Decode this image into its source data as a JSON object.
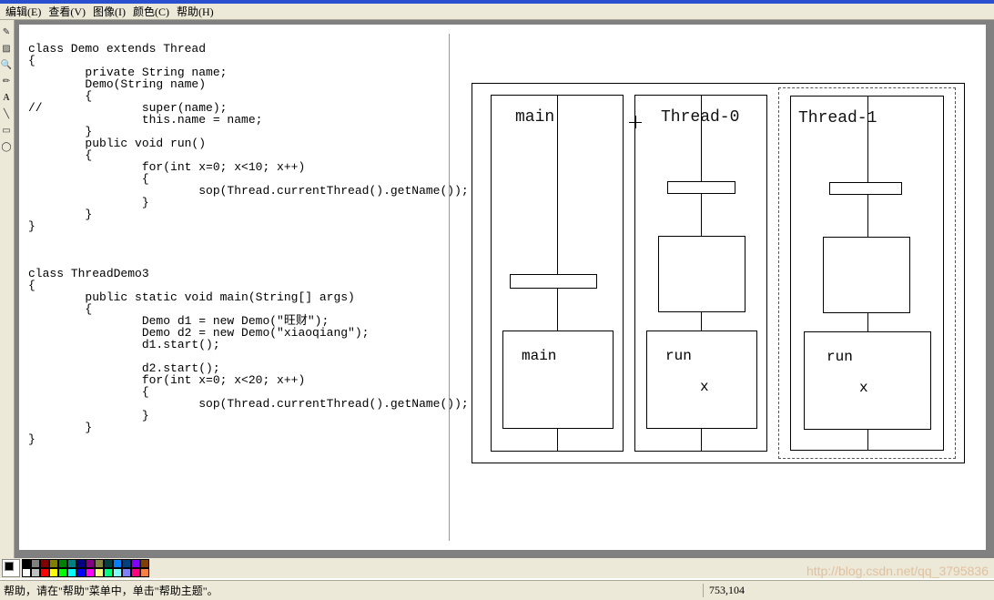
{
  "menu": {
    "edit": "编辑(E)",
    "view": "查看(V)",
    "image": "图像(I)",
    "color": "颜色(C)",
    "help": "帮助(H)"
  },
  "code": {
    "text": "class Demo extends Thread\n{\n        private String name;\n        Demo(String name)\n        {\n//              super(name);\n                this.name = name;\n        }\n        public void run()\n        {\n                for(int x=0; x<10; x++)\n                {\n                        sop(Thread.currentThread().getName());\n                }\n        }\n}\n\n\n\nclass ThreadDemo3\n{\n        public static void main(String[] args)\n        {\n                Demo d1 = new Demo(\"旺财\");\n                Demo d2 = new Demo(\"xiaoqiang\");\n                d1.start();\n\n                d2.start();\n                for(int x=0; x<20; x++)\n                {\n                        sop(Thread.currentThread().getName());\n                }\n        }\n}"
  },
  "diagram": {
    "thread1": {
      "title": "main",
      "box": "main"
    },
    "thread2": {
      "title": "Thread-0",
      "box": "run",
      "var": "x"
    },
    "thread3": {
      "title": "Thread-1",
      "box": "run",
      "var": "x"
    }
  },
  "palette": {
    "row1": [
      "#000000",
      "#808080",
      "#800000",
      "#808000",
      "#008000",
      "#008080",
      "#000080",
      "#800080",
      "#808040",
      "#004040",
      "#0080ff",
      "#004080",
      "#8000ff",
      "#804000"
    ],
    "row2": [
      "#ffffff",
      "#c0c0c0",
      "#ff0000",
      "#ffff00",
      "#00ff00",
      "#00ffff",
      "#0000ff",
      "#ff00ff",
      "#ffff80",
      "#00ff80",
      "#80ffff",
      "#8080ff",
      "#ff0080",
      "#ff8040"
    ]
  },
  "status": {
    "help": "帮助，请在\"帮助\"菜单中，单击\"帮助主题\"。",
    "coords": "753,104"
  },
  "watermark": "http://blog.csdn.net/qq_3795836"
}
